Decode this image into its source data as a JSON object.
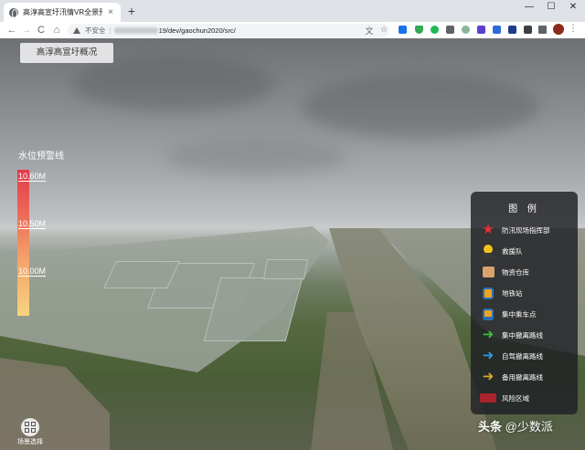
{
  "browser": {
    "tab_title": "高淳高宣圩汛情VR全景预案",
    "tab_close": "×",
    "new_tab": "+",
    "window_controls": [
      "—",
      "☐",
      "✕"
    ],
    "nav": {
      "back": "←",
      "forward": "→",
      "reload": "C",
      "home": "⌂"
    },
    "address": {
      "security_label": "不安全",
      "separator": "|",
      "url_path": "19/dev/gaochun2020/src/"
    },
    "toolbar_icons": [
      "translate-icon",
      "star-icon",
      "shield-icon",
      "evernote-icon",
      "mail-icon",
      "settings-ext-icon",
      "pocket-icon",
      "extensions-icon",
      "profile-avatar",
      "menu-icon"
    ],
    "menu": "⋮"
  },
  "viewer": {
    "overview_button": "高淳高宣圩概况",
    "water_level": {
      "title": "水位预警线",
      "ticks": [
        "10.60M",
        "10.50M",
        "10.00M"
      ]
    },
    "legend": {
      "title": "图 例",
      "items": [
        {
          "label": "防汛现场指挥部",
          "icon": "red-star-icon",
          "color": "#e8302e"
        },
        {
          "label": "救援队",
          "icon": "rescuer-icon",
          "color": "#f2c21a"
        },
        {
          "label": "物资仓库",
          "icon": "warehouse-icon",
          "color": "#d9a36b"
        },
        {
          "label": "地铁站",
          "icon": "metro-icon",
          "color": "#f0a21e"
        },
        {
          "label": "集中乘车点",
          "icon": "bus-icon",
          "color": "#f0a21e"
        },
        {
          "label": "集中撤离路线",
          "icon": "green-arrow-icon",
          "color": "#3fbf3a"
        },
        {
          "label": "自驾撤离路线",
          "icon": "blue-arrow-icon",
          "color": "#2f9be3"
        },
        {
          "label": "备用撤离路线",
          "icon": "yellow-arrow-icon",
          "color": "#d8a92a"
        },
        {
          "label": "风险区域",
          "icon": "risk-area-icon",
          "color": "#a8232b"
        }
      ]
    },
    "scene_select": "场景选择",
    "watermark": {
      "prefix": "头条",
      "at": "@",
      "name": "少数派"
    }
  }
}
